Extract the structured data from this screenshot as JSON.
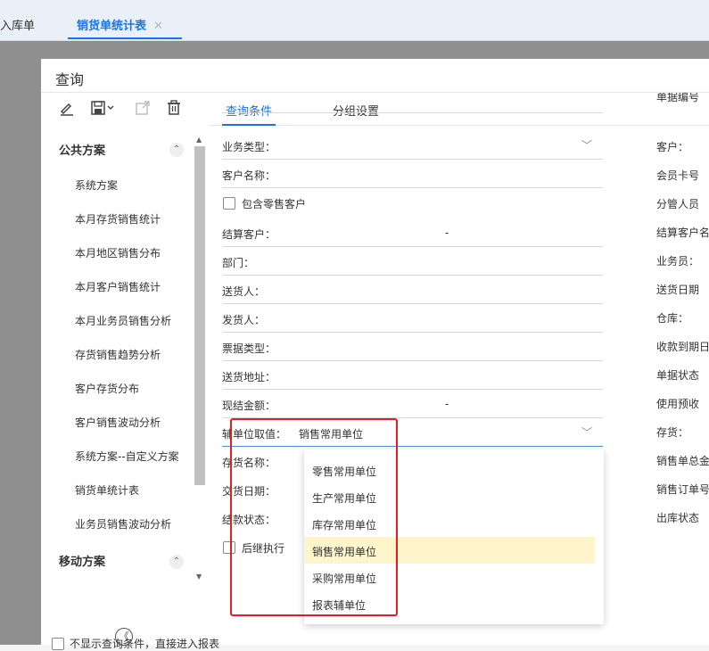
{
  "tabs": {
    "inactive": "入库单",
    "active": "销货单统计表",
    "close_glyph": "✕"
  },
  "dialog": {
    "title": "查询"
  },
  "left": {
    "toolbar_icons": [
      "edit-icon",
      "save-icon",
      "export-icon",
      "delete-icon"
    ],
    "public_group": "公共方案",
    "mobile_group": "移动方案",
    "schemes": [
      "系统方案",
      "本月存货销售统计",
      "本月地区销售分布",
      "本月客户销售统计",
      "本月业务员销售分析",
      "存货销售趋势分析",
      "客户存货分布",
      "客户销售波动分析",
      "系统方案--自定义方案",
      "销货单统计表",
      "业务员销售波动分析"
    ],
    "collapse_glyph": "《"
  },
  "right": {
    "tab_conditions": "查询条件",
    "tab_group": "分组设置",
    "rows": {
      "business_type": "业务类型：",
      "customer_name": "客户名称：",
      "include_retail": "包含零售客户",
      "settle_customer": "结算客户：",
      "department": "部门：",
      "deliverer": "送货人：",
      "shipper": "发货人：",
      "bill_type": "票据类型：",
      "delivery_address": "送货地址：",
      "cash_amount": "现结金额：",
      "aux_unit": "辅单位取值：",
      "aux_unit_value": "销售常用单位",
      "inventory_name": "存货名称：",
      "delivery_date": "交货日期：",
      "settle_status": "结款状态：",
      "follow_exec": "后继执行",
      "dash": "-"
    },
    "right_col": [
      "单据编号",
      "客户：",
      "会员卡号",
      "分管人员",
      "结算客户名",
      "业务员：",
      "送货日期",
      "仓库：",
      "收款到期日",
      "单据状态",
      "使用预收",
      "存货：",
      "销售单总金",
      "销售订单号",
      "出库状态"
    ],
    "dropdown_options": [
      "零售常用单位",
      "生产常用单位",
      "库存常用单位",
      "销售常用单位",
      "采购常用单位",
      "报表辅单位"
    ],
    "selected_option": "销售常用单位"
  },
  "bottom": {
    "skip_text": "不显示查询条件，直接进入报表"
  }
}
